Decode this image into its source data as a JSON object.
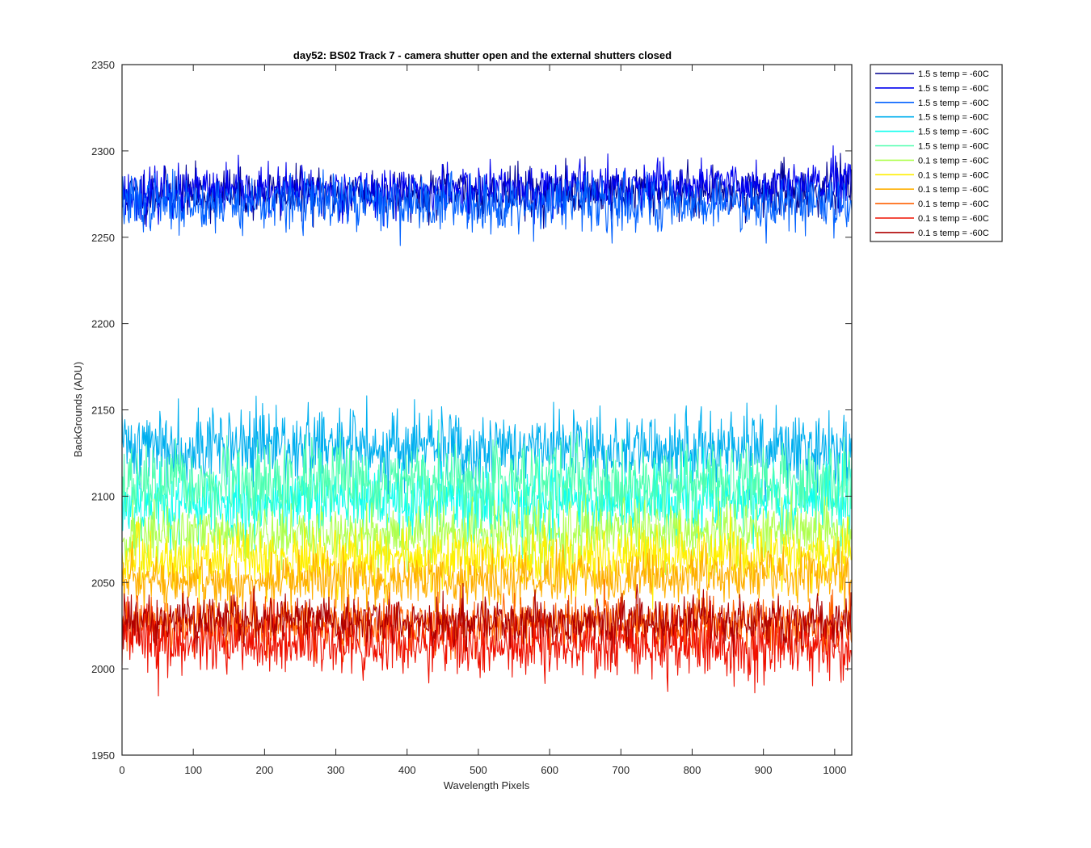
{
  "chart_data": {
    "type": "line",
    "title": "day52: BS02  Track 7 - camera shutter open and the external shutters closed",
    "xlabel": "Wavelength Pixels",
    "ylabel": "BackGrounds (ADU)",
    "xlim": [
      0,
      1024
    ],
    "ylim": [
      1950,
      2350
    ],
    "xticks": [
      0,
      100,
      200,
      300,
      400,
      500,
      600,
      700,
      800,
      900,
      1000
    ],
    "yticks": [
      1950,
      2000,
      2050,
      2100,
      2150,
      2200,
      2250,
      2300,
      2350
    ],
    "grid": false,
    "legend_position": "outside-top-right",
    "n_points_per_series": 1024,
    "series": [
      {
        "name": "1.5 s temp = -60C",
        "color": "#00008F",
        "mean": 2276,
        "spread": 7,
        "trend": 2,
        "seed": 11
      },
      {
        "name": "1.5 s temp = -60C",
        "color": "#0000EF",
        "mean": 2278,
        "spread": 7,
        "trend": 6,
        "seed": 23
      },
      {
        "name": "1.5 s temp = -60C",
        "color": "#0060FF",
        "mean": 2270,
        "spread": 8,
        "trend": 0,
        "seed": 37
      },
      {
        "name": "1.5 s temp = -60C",
        "color": "#00AFEF",
        "mean": 2128,
        "spread": 11,
        "trend": -4,
        "seed": 41
      },
      {
        "name": "1.5 s temp = -60C",
        "color": "#10FFEF",
        "mean": 2097,
        "spread": 11,
        "trend": 2,
        "seed": 53
      },
      {
        "name": "1.5 s temp = -60C",
        "color": "#50FFAF",
        "mean": 2107,
        "spread": 11,
        "trend": 3,
        "seed": 67
      },
      {
        "name": "0.1 s temp = -60C",
        "color": "#AFFF50",
        "mean": 2078,
        "spread": 9,
        "trend": 2,
        "seed": 71
      },
      {
        "name": "0.1 s temp = -60C",
        "color": "#FFEF00",
        "mean": 2064,
        "spread": 9,
        "trend": 3,
        "seed": 83
      },
      {
        "name": "0.1 s temp = -60C",
        "color": "#FFAF00",
        "mean": 2052,
        "spread": 8,
        "trend": 6,
        "seed": 97
      },
      {
        "name": "0.1 s temp = -60C",
        "color": "#FF6000",
        "mean": 2026,
        "spread": 8,
        "trend": 0,
        "seed": 101
      },
      {
        "name": "0.1 s temp = -60C",
        "color": "#EF1000",
        "mean": 2014,
        "spread": 9,
        "trend": -4,
        "seed": 113
      },
      {
        "name": "0.1 s temp = -60C",
        "color": "#AF0000",
        "mean": 2028,
        "spread": 7,
        "trend": 0,
        "seed": 127
      }
    ]
  }
}
